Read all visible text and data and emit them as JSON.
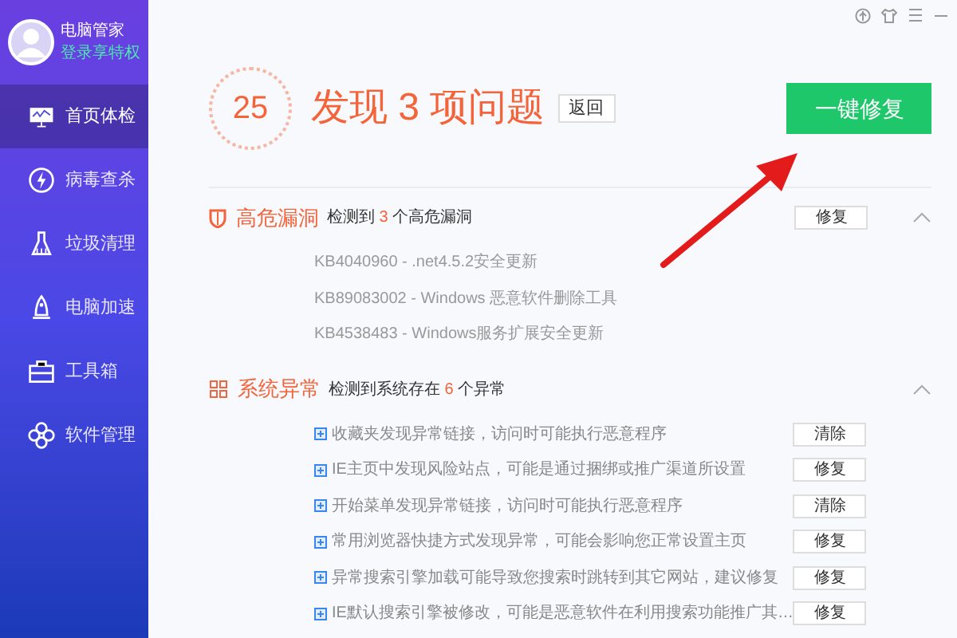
{
  "profile": {
    "name": "电脑管家",
    "link": "登录享特权"
  },
  "nav": [
    {
      "label": "首页体检",
      "selected": true
    },
    {
      "label": "病毒查杀",
      "selected": false
    },
    {
      "label": "垃圾清理",
      "selected": false
    },
    {
      "label": "电脑加速",
      "selected": false
    },
    {
      "label": "工具箱",
      "selected": false
    },
    {
      "label": "软件管理",
      "selected": false
    }
  ],
  "header": {
    "score": "25",
    "title": "发现 3 项问题",
    "back_button": "返回",
    "fix_all_button": "一键修复"
  },
  "sections": [
    {
      "kind": "vulnerability",
      "title": "高危漏洞",
      "detail_prefix": "检测到",
      "count": "3",
      "detail_suffix": "个高危漏洞",
      "button": "修复",
      "expanded": true,
      "items": [
        {
          "text": "KB4040960 - .net4.5.2安全更新"
        },
        {
          "text": "KB89083002 - Windows 恶意软件删除工具"
        },
        {
          "text": "KB4538483 - Windows服务扩展安全更新"
        }
      ]
    },
    {
      "kind": "anomaly",
      "title": "系统异常",
      "detail_prefix": "检测到系统存在",
      "count": "6",
      "detail_suffix": "个异常",
      "expanded": true,
      "items": [
        {
          "text": "收藏夹发现异常链接，访问时可能执行恶意程序",
          "button": "清除"
        },
        {
          "text": "IE主页中发现风险站点，可能是通过捆绑或推广渠道所设置",
          "button": "修复"
        },
        {
          "text": "开始菜单发现异常链接，访问时可能执行恶意程序",
          "button": "清除"
        },
        {
          "text": "常用浏览器快捷方式发现异常，可能会影响您正常设置主页",
          "button": "修复"
        },
        {
          "text": "异常搜索引擎加载可能导致您搜索时跳转到其它网站，建议修复",
          "button": "修复"
        },
        {
          "text": "IE默认搜索引擎被修改，可能是恶意软件在利用搜索功能推广其…",
          "button": "修复"
        }
      ]
    }
  ]
}
